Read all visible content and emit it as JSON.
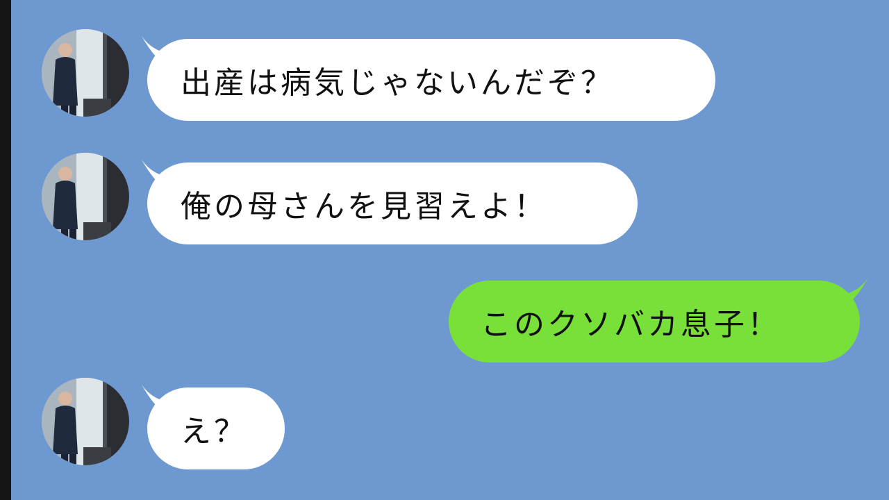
{
  "chat": {
    "colors": {
      "background": "#6e99d0",
      "incoming_bubble": "#ffffff",
      "outgoing_bubble": "#79e03a",
      "text": "#111111"
    },
    "messages": [
      {
        "side": "incoming",
        "text": "出産は病気じゃないんだぞ？",
        "avatar": "man-in-suit-avatar"
      },
      {
        "side": "incoming",
        "text": "俺の母さんを見習えよ！",
        "avatar": "man-in-suit-avatar"
      },
      {
        "side": "outgoing",
        "text": "このクソバカ息子！"
      },
      {
        "side": "incoming",
        "text": "え？",
        "avatar": "man-in-suit-avatar"
      }
    ]
  }
}
